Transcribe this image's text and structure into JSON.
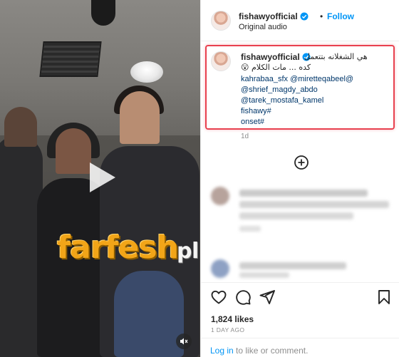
{
  "post": {
    "username": "fishawyofficial",
    "follow_label": "Follow",
    "separator": "•",
    "audio_label": "Original audio"
  },
  "caption": {
    "line1": "هي الشغلانه بتتعمل",
    "line2": "كده ... مات الكلام 😮",
    "mentions_1": "kahrabaa_sfx @miretteqabeel@",
    "mentions_2": "@shrief_magdy_abdo",
    "mentions_3": "@tarek_mostafa_kamel",
    "hashtag_1": "fishawy#",
    "hashtag_2": "onset#",
    "time_ago": "1d"
  },
  "watermark": {
    "main": "farfesh",
    "sub": "plus.com"
  },
  "stats": {
    "likes": "1,824 likes",
    "date": "1 DAY AGO"
  },
  "login": {
    "link": "Log in",
    "rest": " to like or comment."
  },
  "colors": {
    "follow_blue": "#0095f6",
    "highlight_red": "#e8414f",
    "watermark_orange": "#f2a518"
  },
  "icons": {
    "verified": "verified-badge-icon",
    "play": "play-icon",
    "mute": "mute-icon",
    "add": "add-comments-icon",
    "like": "heart-icon",
    "comment": "comment-icon",
    "share": "share-icon",
    "save": "bookmark-icon"
  }
}
